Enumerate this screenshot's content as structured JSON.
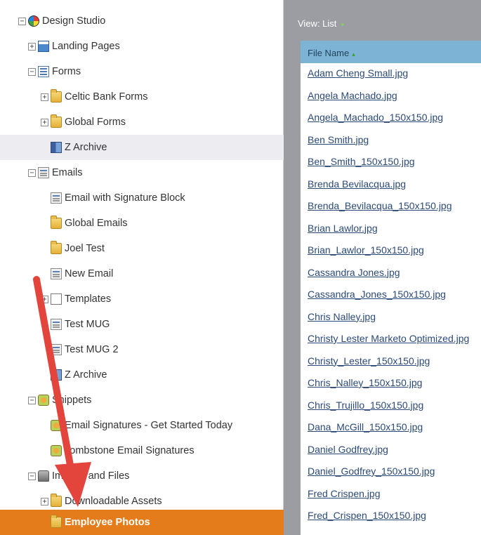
{
  "tree": {
    "items": [
      {
        "label": "Design Studio",
        "level": 0,
        "toggle": "−",
        "icon": "design-studio-icon"
      },
      {
        "label": "Landing Pages",
        "level": 1,
        "toggle": "+",
        "icon": "landing-pages-icon"
      },
      {
        "label": "Forms",
        "level": 1,
        "toggle": "−",
        "icon": "forms-icon"
      },
      {
        "label": "Celtic Bank Forms",
        "level": 2,
        "toggle": "+",
        "icon": "folder-icon"
      },
      {
        "label": "Global Forms",
        "level": 2,
        "toggle": "+",
        "icon": "folder-icon"
      },
      {
        "label": "Z Archive",
        "level": 2,
        "toggle": "",
        "icon": "archive-icon",
        "highlight": true
      },
      {
        "label": "Emails",
        "level": 1,
        "toggle": "−",
        "icon": "emails-icon"
      },
      {
        "label": "Email with Signature Block",
        "level": 2,
        "toggle": "",
        "icon": "email-icon"
      },
      {
        "label": "Global Emails",
        "level": 2,
        "toggle": "",
        "icon": "folder-icon"
      },
      {
        "label": "Joel Test",
        "level": 2,
        "toggle": "",
        "icon": "folder-icon"
      },
      {
        "label": "New Email",
        "level": 2,
        "toggle": "",
        "icon": "email-icon"
      },
      {
        "label": "Templates",
        "level": 2,
        "toggle": "+",
        "icon": "template-icon"
      },
      {
        "label": "Test MUG",
        "level": 2,
        "toggle": "",
        "icon": "email-icon"
      },
      {
        "label": "Test MUG 2",
        "level": 2,
        "toggle": "",
        "icon": "email-icon"
      },
      {
        "label": "Z Archive",
        "level": 2,
        "toggle": "",
        "icon": "archive-icon"
      },
      {
        "label": "Snippets",
        "level": 1,
        "toggle": "−",
        "icon": "snippets-icon"
      },
      {
        "label": "Email Signatures - Get Started Today",
        "level": 2,
        "toggle": "",
        "icon": "snippet-icon"
      },
      {
        "label": "Tombstone Email Signatures",
        "level": 2,
        "toggle": "",
        "icon": "snippet-icon"
      },
      {
        "label": "Images and Files",
        "level": 1,
        "toggle": "−",
        "icon": "images-icon"
      },
      {
        "label": "Downloadable Assets",
        "level": 2,
        "toggle": "+",
        "icon": "folder-icon"
      },
      {
        "label": "Employee Photos",
        "level": 2,
        "toggle": "",
        "icon": "folder-icon",
        "selected": true
      }
    ]
  },
  "grid": {
    "view_label": "View: List",
    "view_arrow": "▾",
    "column_header": "File Name",
    "sort_indicator": "▴",
    "files": [
      "Adam Cheng Small.jpg",
      "Angela Machado.jpg",
      "Angela_Machado_150x150.jpg",
      "Ben Smith.jpg",
      "Ben_Smith_150x150.jpg",
      "Brenda Bevilacqua.jpg",
      "Brenda_Bevilacqua_150x150.jpg",
      "Brian Lawlor.jpg",
      "Brian_Lawlor_150x150.jpg",
      "Cassandra Jones.jpg",
      "Cassandra_Jones_150x150.jpg",
      "Chris Nalley.jpg",
      "Christy Lester Marketo Optimized.jpg",
      "Christy_Lester_150x150.jpg",
      "Chris_Nalley_150x150.jpg",
      "Chris_Trujillo_150x150.jpg",
      "Dana_McGill_150x150.jpg",
      "Daniel Godfrey.jpg",
      "Daniel_Godfrey_150x150.jpg",
      "Fred Crispen.jpg",
      "Fred_Crispen_150x150.jpg"
    ]
  },
  "colors": {
    "selected": "#e47c1c",
    "grid_bg": "#9c9da3",
    "column_header": "#7db3d4",
    "annotation_arrow": "#e3443c"
  }
}
